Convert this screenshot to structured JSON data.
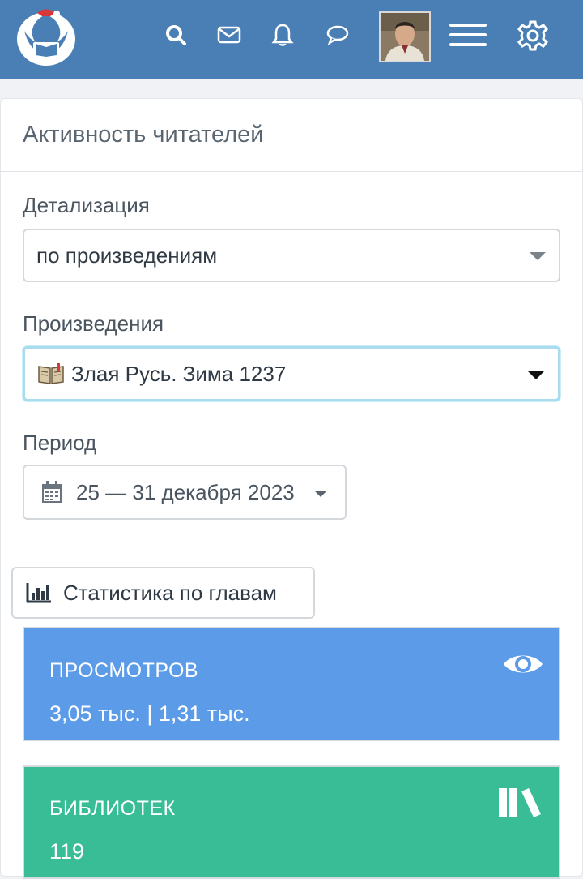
{
  "header": {
    "icons": [
      "logo-icon",
      "search-icon",
      "mail-icon",
      "bell-icon",
      "chat-icon",
      "avatar",
      "menu-icon",
      "gear-icon"
    ]
  },
  "card": {
    "title": "Активность читателей"
  },
  "detail": {
    "label": "Детализация",
    "value": "по произведениям"
  },
  "works": {
    "label": "Произведения",
    "value": "Злая Русь. Зима 1237"
  },
  "period": {
    "label": "Период",
    "value": "25 — 31 декабря 2023"
  },
  "chapters_button": {
    "label": "Статистика по главам"
  },
  "tiles": [
    {
      "heading": "ПРОСМОТРОВ",
      "value": "3,05 тыс. | 1,31 тыс.",
      "color": "#5b9be8",
      "icon": "eye-icon"
    },
    {
      "heading": "БИБЛИОТЕК",
      "value": "119",
      "color": "#38bd97",
      "icon": "books-icon"
    }
  ],
  "colors": {
    "header": "#4a7fb5",
    "focus": "#a8dcee"
  }
}
